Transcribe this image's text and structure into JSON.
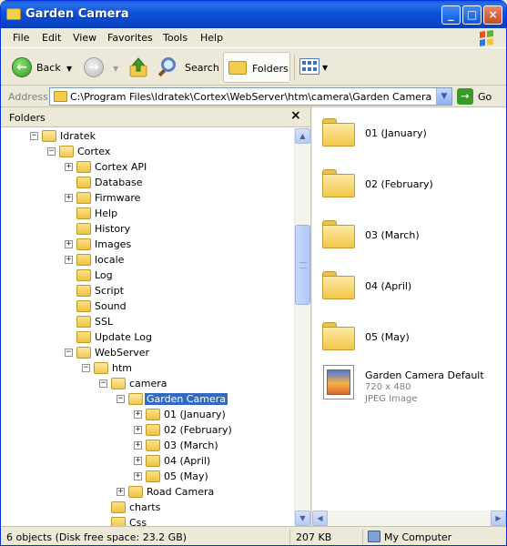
{
  "window": {
    "title": "Garden Camera",
    "controls": {
      "minimize": "_",
      "maximize": "□",
      "close": "×"
    }
  },
  "menu": [
    "File",
    "Edit",
    "View",
    "Favorites",
    "Tools",
    "Help"
  ],
  "toolbar": {
    "back_label": "Back",
    "search_label": "Search",
    "folders_label": "Folders"
  },
  "address": {
    "label": "Address",
    "path": "C:\\Program Files\\Idratek\\Cortex\\WebServer\\htm\\camera\\Garden Camera",
    "go_label": "Go"
  },
  "folders_pane": {
    "title": "Folders",
    "close": "×",
    "tree": [
      {
        "label": "Idratek",
        "expander": "−",
        "open": true
      },
      {
        "label": "Cortex",
        "expander": "−",
        "open": true
      },
      {
        "label": "Cortex API",
        "expander": "+"
      },
      {
        "label": "Database",
        "expander": ""
      },
      {
        "label": "Firmware",
        "expander": "+"
      },
      {
        "label": "Help",
        "expander": ""
      },
      {
        "label": "History",
        "expander": ""
      },
      {
        "label": "Images",
        "expander": "+"
      },
      {
        "label": "locale",
        "expander": "+"
      },
      {
        "label": "Log",
        "expander": ""
      },
      {
        "label": "Script",
        "expander": ""
      },
      {
        "label": "Sound",
        "expander": ""
      },
      {
        "label": "SSL",
        "expander": ""
      },
      {
        "label": "Update Log",
        "expander": ""
      },
      {
        "label": "WebServer",
        "expander": "−",
        "open": true
      },
      {
        "label": "htm",
        "expander": "−",
        "open": true
      },
      {
        "label": "camera",
        "expander": "−",
        "open": true
      },
      {
        "label": "Garden Camera",
        "expander": "−",
        "open": true,
        "selected": true
      },
      {
        "label": "01 (January)",
        "expander": "+"
      },
      {
        "label": "02 (February)",
        "expander": "+"
      },
      {
        "label": "03 (March)",
        "expander": "+"
      },
      {
        "label": "04 (April)",
        "expander": "+"
      },
      {
        "label": "05 (May)",
        "expander": "+"
      },
      {
        "label": "Road Camera",
        "expander": "+"
      },
      {
        "label": "charts",
        "expander": ""
      },
      {
        "label": "Css",
        "expander": ""
      }
    ]
  },
  "content": {
    "folders": [
      "01 (January)",
      "02 (February)",
      "03 (March)",
      "04 (April)",
      "05 (May)"
    ],
    "file": {
      "name": "Garden Camera Default",
      "dimensions": "720 x 480",
      "type": "JPEG Image"
    }
  },
  "status": {
    "objects": "6 objects (Disk free space: 23.2 GB)",
    "size": "207 KB",
    "location": "My Computer"
  },
  "colors": {
    "titlebar": "#0b52d8",
    "selection": "#316ac5",
    "folder": "#f2c84a"
  }
}
